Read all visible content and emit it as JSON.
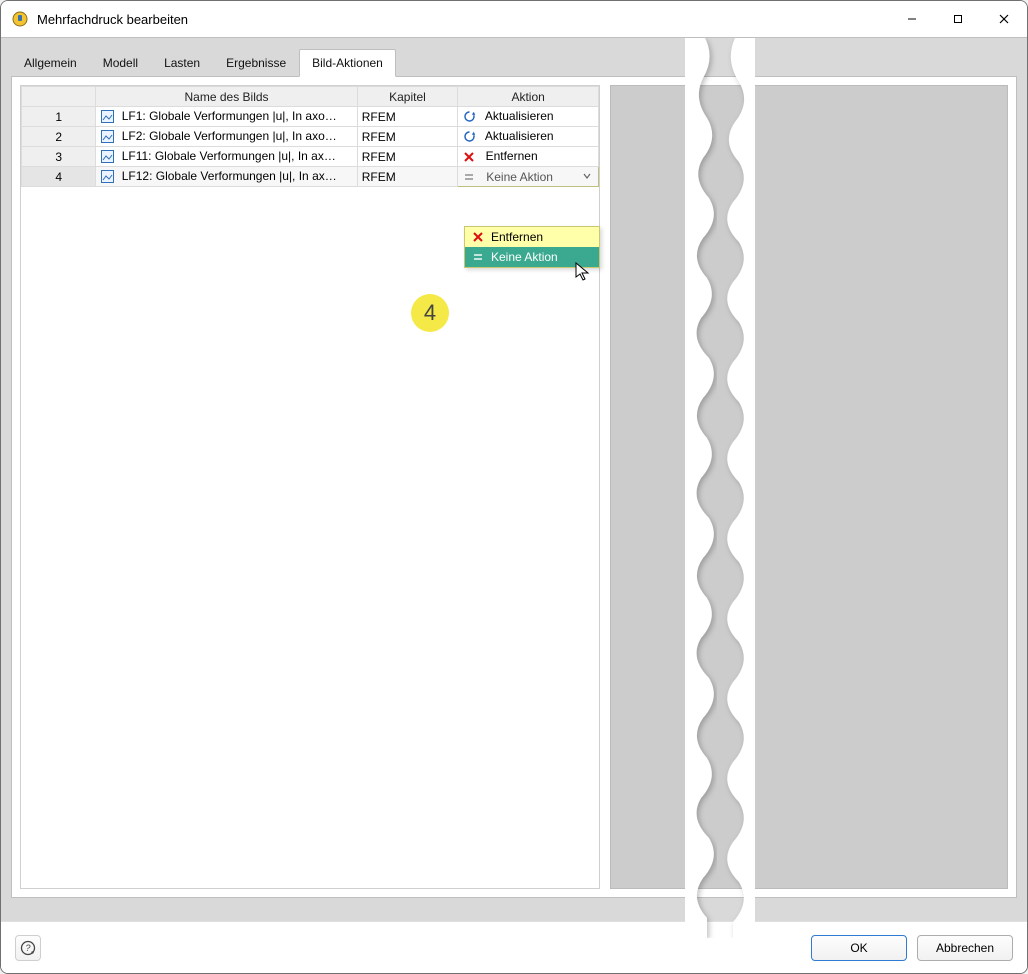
{
  "window": {
    "title": "Mehrfachdruck bearbeiten"
  },
  "tabs": [
    {
      "id": "allgemein",
      "label": "Allgemein",
      "active": false
    },
    {
      "id": "modell",
      "label": "Modell",
      "active": false
    },
    {
      "id": "lasten",
      "label": "Lasten",
      "active": false
    },
    {
      "id": "ergebnisse",
      "label": "Ergebnisse",
      "active": false
    },
    {
      "id": "bild",
      "label": "Bild-Aktionen",
      "active": true
    }
  ],
  "grid": {
    "headers": {
      "num": "",
      "name": "Name des Bilds",
      "chapter": "Kapitel",
      "action": "Aktion"
    },
    "rows": [
      {
        "num": "1",
        "name": "LF1: Globale Verformungen |u|, In axo…",
        "chapter": "RFEM",
        "action": "Aktualisieren",
        "action_icon": "refresh"
      },
      {
        "num": "2",
        "name": "LF2: Globale Verformungen |u|, In axo…",
        "chapter": "RFEM",
        "action": "Aktualisieren",
        "action_icon": "refresh"
      },
      {
        "num": "3",
        "name": "LF11: Globale Verformungen |u|, In ax…",
        "chapter": "RFEM",
        "action": "Entfernen",
        "action_icon": "remove"
      },
      {
        "num": "4",
        "name": "LF12: Globale Verformungen |u|, In ax…",
        "chapter": "RFEM",
        "action": "Keine Aktion",
        "action_icon": "none",
        "editing": true
      }
    ]
  },
  "dropdown": {
    "current": "Keine Aktion",
    "options": [
      {
        "label": "Entfernen",
        "icon": "remove",
        "hover": false
      },
      {
        "label": "Keine Aktion",
        "icon": "none",
        "hover": true
      }
    ]
  },
  "badge": {
    "text": "4"
  },
  "footer": {
    "ok": "OK",
    "cancel": "Abbrechen"
  }
}
